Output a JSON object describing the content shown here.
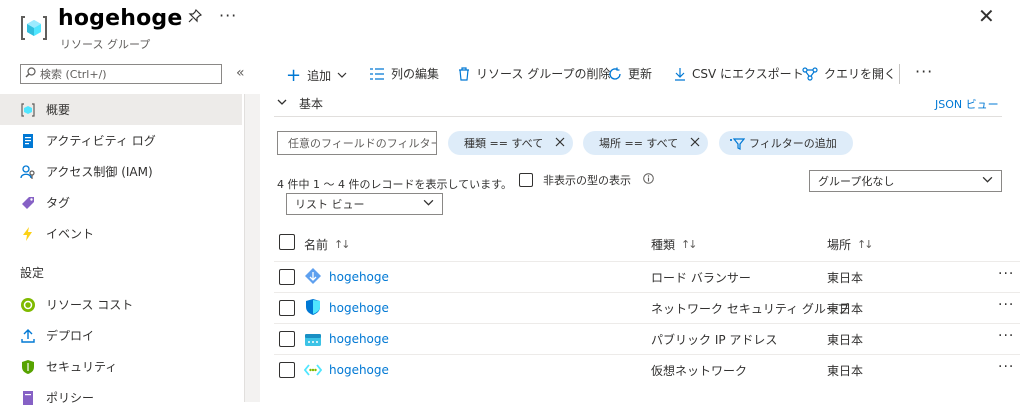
{
  "header": {
    "title": "hogehoge",
    "subtitle": "リソース グループ",
    "more": "···",
    "close": "✕"
  },
  "sidebar": {
    "search_placeholder": "検索 (Ctrl+/)",
    "collapse": "«",
    "items": [
      {
        "label": "概要",
        "icon": "resource-group-icon",
        "active": true
      },
      {
        "label": "アクティビティ ログ",
        "icon": "activity-log-icon"
      },
      {
        "label": "アクセス制御 (IAM)",
        "icon": "iam-icon"
      },
      {
        "label": "タグ",
        "icon": "tag-icon"
      },
      {
        "label": "イベント",
        "icon": "lightning-icon"
      }
    ],
    "section_label": "設定",
    "settings_items": [
      {
        "label": "リソース コスト",
        "icon": "cost-icon"
      },
      {
        "label": "デプロイ",
        "icon": "deploy-icon"
      },
      {
        "label": "セキュリティ",
        "icon": "security-icon"
      },
      {
        "label": "ポリシー",
        "icon": "policy-icon"
      }
    ]
  },
  "toolbar": {
    "add": "追加",
    "edit_columns": "列の編集",
    "delete_rg": "リソース グループの削除",
    "refresh": "更新",
    "export_csv": "CSV にエクスポート",
    "open_query": "クエリを開く",
    "more": "···"
  },
  "essentials": {
    "label": "基本",
    "json_view": "JSON ビュー"
  },
  "filters": {
    "field_placeholder": "任意のフィールドのフィルター...",
    "type_pill": "種類 == すべて",
    "location_pill": "場所 == すべて",
    "add_filter": "フィルターの追加"
  },
  "records": {
    "summary": "4 件中 1 ～ 4 件のレコードを表示しています。",
    "show_hidden_types": "非表示の型の表示",
    "grouping": "グループ化なし",
    "view": "リスト ビュー"
  },
  "table": {
    "columns": {
      "name": "名前",
      "type": "種類",
      "location": "場所"
    },
    "rows": [
      {
        "name": "hogehoge",
        "type": "ロード バランサー",
        "location": "東日本",
        "icon": "load-balancer-icon"
      },
      {
        "name": "hogehoge",
        "type": "ネットワーク セキュリティ グループ",
        "location": "東日本",
        "icon": "network-security-group-icon"
      },
      {
        "name": "hogehoge",
        "type": "パブリック IP アドレス",
        "location": "東日本",
        "icon": "public-ip-icon"
      },
      {
        "name": "hogehoge",
        "type": "仮想ネットワーク",
        "location": "東日本",
        "icon": "virtual-network-icon"
      }
    ],
    "row_more": "···"
  },
  "colors": {
    "accent": "#0078d4",
    "pill_bg": "#deecf9",
    "selected_nav": "#edebe9"
  }
}
